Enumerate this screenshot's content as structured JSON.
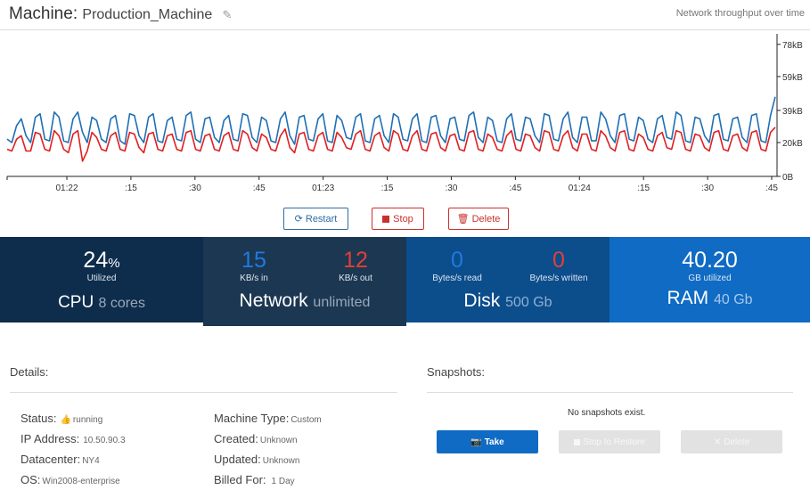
{
  "header": {
    "label": "Machine:",
    "machine_name": "Production_Machine",
    "edit_icon": "pencil-icon",
    "right_caption": "Network throughput over time"
  },
  "chart_data": {
    "type": "line",
    "title": "",
    "xlabel": "",
    "ylabel": "",
    "y_tick_labels": [
      "78kB",
      "59kB",
      "39kB",
      "20kB",
      "0B"
    ],
    "y_ticks": [
      78,
      59,
      39,
      20,
      0
    ],
    "ylim": [
      0,
      80
    ],
    "x_tick_labels": [
      "01:22",
      ":15",
      ":30",
      ":45",
      "01:23",
      ":15",
      ":30",
      ":45",
      "01:24",
      ":15",
      ":30",
      ":45"
    ],
    "x_range_seconds": [
      0,
      174
    ],
    "series": [
      {
        "color": "#1f6fb5",
        "values": [
          22,
          20,
          30,
          34,
          24,
          20,
          35,
          37,
          22,
          21,
          38,
          35,
          21,
          20,
          34,
          38,
          26,
          20,
          35,
          33,
          22,
          20,
          34,
          36,
          21,
          19,
          37,
          36,
          24,
          20,
          35,
          37,
          21,
          20,
          33,
          35,
          22,
          21,
          36,
          38,
          22,
          20,
          34,
          35,
          23,
          20,
          33,
          36,
          22,
          21,
          37,
          36,
          23,
          20,
          35,
          33,
          21,
          20,
          34,
          38,
          24,
          19,
          35,
          36,
          22,
          21,
          34,
          37,
          21,
          20,
          36,
          33,
          23,
          22,
          35,
          37,
          21,
          20,
          34,
          36,
          24,
          20,
          37,
          35,
          22,
          21,
          34,
          37,
          21,
          20,
          35,
          36,
          24,
          20,
          34,
          35,
          22,
          21,
          36,
          38,
          23,
          20,
          35,
          33,
          21,
          20,
          34,
          37,
          22,
          21,
          35,
          34,
          24,
          20,
          37,
          36,
          22,
          21,
          34,
          38,
          23,
          20,
          35,
          35,
          21,
          21,
          38,
          34,
          24,
          20,
          36,
          37,
          22,
          21,
          35,
          33,
          22,
          20,
          34,
          36,
          23,
          22,
          38,
          36,
          21,
          20,
          35,
          34,
          24,
          20,
          36,
          37,
          22,
          21,
          34,
          35,
          23,
          20,
          36,
          37,
          21,
          20,
          36,
          47
        ]
      },
      {
        "color": "#e02020",
        "values": [
          16,
          15,
          22,
          24,
          15,
          15,
          26,
          25,
          16,
          15,
          27,
          24,
          16,
          14,
          25,
          27,
          9,
          15,
          26,
          23,
          16,
          15,
          24,
          26,
          16,
          15,
          26,
          25,
          17,
          14,
          25,
          26,
          16,
          15,
          24,
          25,
          16,
          15,
          26,
          27,
          16,
          15,
          24,
          25,
          16,
          15,
          24,
          26,
          16,
          15,
          27,
          25,
          17,
          15,
          25,
          23,
          16,
          15,
          24,
          28,
          17,
          14,
          25,
          26,
          16,
          15,
          24,
          26,
          16,
          15,
          26,
          23,
          17,
          16,
          25,
          27,
          16,
          15,
          24,
          26,
          17,
          15,
          27,
          25,
          16,
          15,
          24,
          27,
          16,
          15,
          25,
          26,
          17,
          15,
          24,
          25,
          16,
          15,
          26,
          27,
          16,
          15,
          25,
          23,
          16,
          15,
          24,
          27,
          16,
          15,
          25,
          24,
          17,
          15,
          27,
          26,
          16,
          15,
          24,
          27,
          17,
          15,
          25,
          25,
          16,
          15,
          27,
          24,
          17,
          15,
          26,
          27,
          16,
          15,
          25,
          23,
          16,
          15,
          24,
          26,
          17,
          16,
          27,
          26,
          16,
          15,
          25,
          24,
          17,
          15,
          26,
          27,
          16,
          15,
          24,
          25,
          17,
          15,
          26,
          27,
          16,
          15,
          26,
          29
        ]
      }
    ]
  },
  "actions": {
    "restart_label": "Restart",
    "stop_label": "Stop",
    "delete_label": "Delete",
    "restart_icon": "refresh-icon",
    "delete_icon": "trash-icon",
    "colors": {
      "primary": "#2e6da4",
      "danger": "#c9302c"
    }
  },
  "stats": {
    "cpu": {
      "value": "24",
      "unit": "%",
      "caption": "Utilized",
      "title": "CPU",
      "sub": "8 cores"
    },
    "network": {
      "in_value": "15",
      "in_caption": "KB/s in",
      "out_value": "12",
      "out_caption": "KB/s out",
      "title": "Network",
      "sub": "unlimited"
    },
    "disk": {
      "read_value": "0",
      "read_caption": "Bytes/s read",
      "write_value": "0",
      "write_caption": "Bytes/s written",
      "title": "Disk",
      "sub": "500 Gb"
    },
    "ram": {
      "value": "40.20",
      "caption": "GB utilized",
      "title": "RAM",
      "sub": "40 Gb"
    },
    "colors": {
      "cpu": "#0e2c4b",
      "network": "#1c3752",
      "disk": "#0c4d8c",
      "ram": "#0f6bc4",
      "in": "#1f7ae0",
      "out": "#e0403a"
    }
  },
  "details": {
    "title": "Details:",
    "status_label": "Status:",
    "status_icon": "thumbs-up-icon",
    "status_value": "running",
    "ip_label": "IP Address:",
    "ip_value": "10.50.90.3",
    "dc_label": "Datacenter:",
    "dc_value": "NY4",
    "os_label": "OS:",
    "os_value": "Win2008-enterprise",
    "type_label": "Machine Type:",
    "type_value": "Custom",
    "created_label": "Created:",
    "created_value": "Unknown",
    "updated_label": "Updated:",
    "updated_value": "Unknown",
    "billed_label": "Billed For:",
    "billed_value": "1 Day"
  },
  "snapshots": {
    "title": "Snapshots:",
    "empty_text": "No snapshots exist.",
    "take_label": "Take",
    "take_icon": "camera-icon",
    "restore_label": "Stop to Restore",
    "delete_label": "Delete"
  }
}
